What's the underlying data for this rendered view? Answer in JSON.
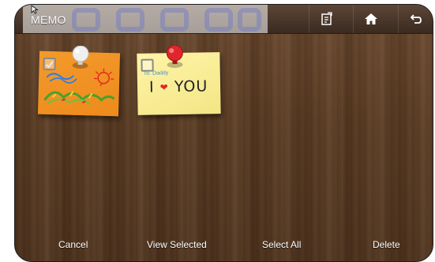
{
  "header": {
    "title": "MEMO",
    "buttons": [
      {
        "icon": "memo-add-icon"
      },
      {
        "icon": "home-icon"
      },
      {
        "icon": "back-icon"
      }
    ]
  },
  "notes": [
    {
      "color": "#f0901f",
      "pin_color": "#e8e8e8",
      "checked": true,
      "content": "drawing"
    },
    {
      "color": "#f7eb95",
      "pin_color": "#e0262b",
      "checked": false,
      "to": "To. Daddy",
      "message_start": "I",
      "message_end": "YOU"
    }
  ],
  "footer": {
    "cancel": "Cancel",
    "view_selected": "View Selected",
    "select_all": "Select All",
    "delete": "Delete"
  }
}
